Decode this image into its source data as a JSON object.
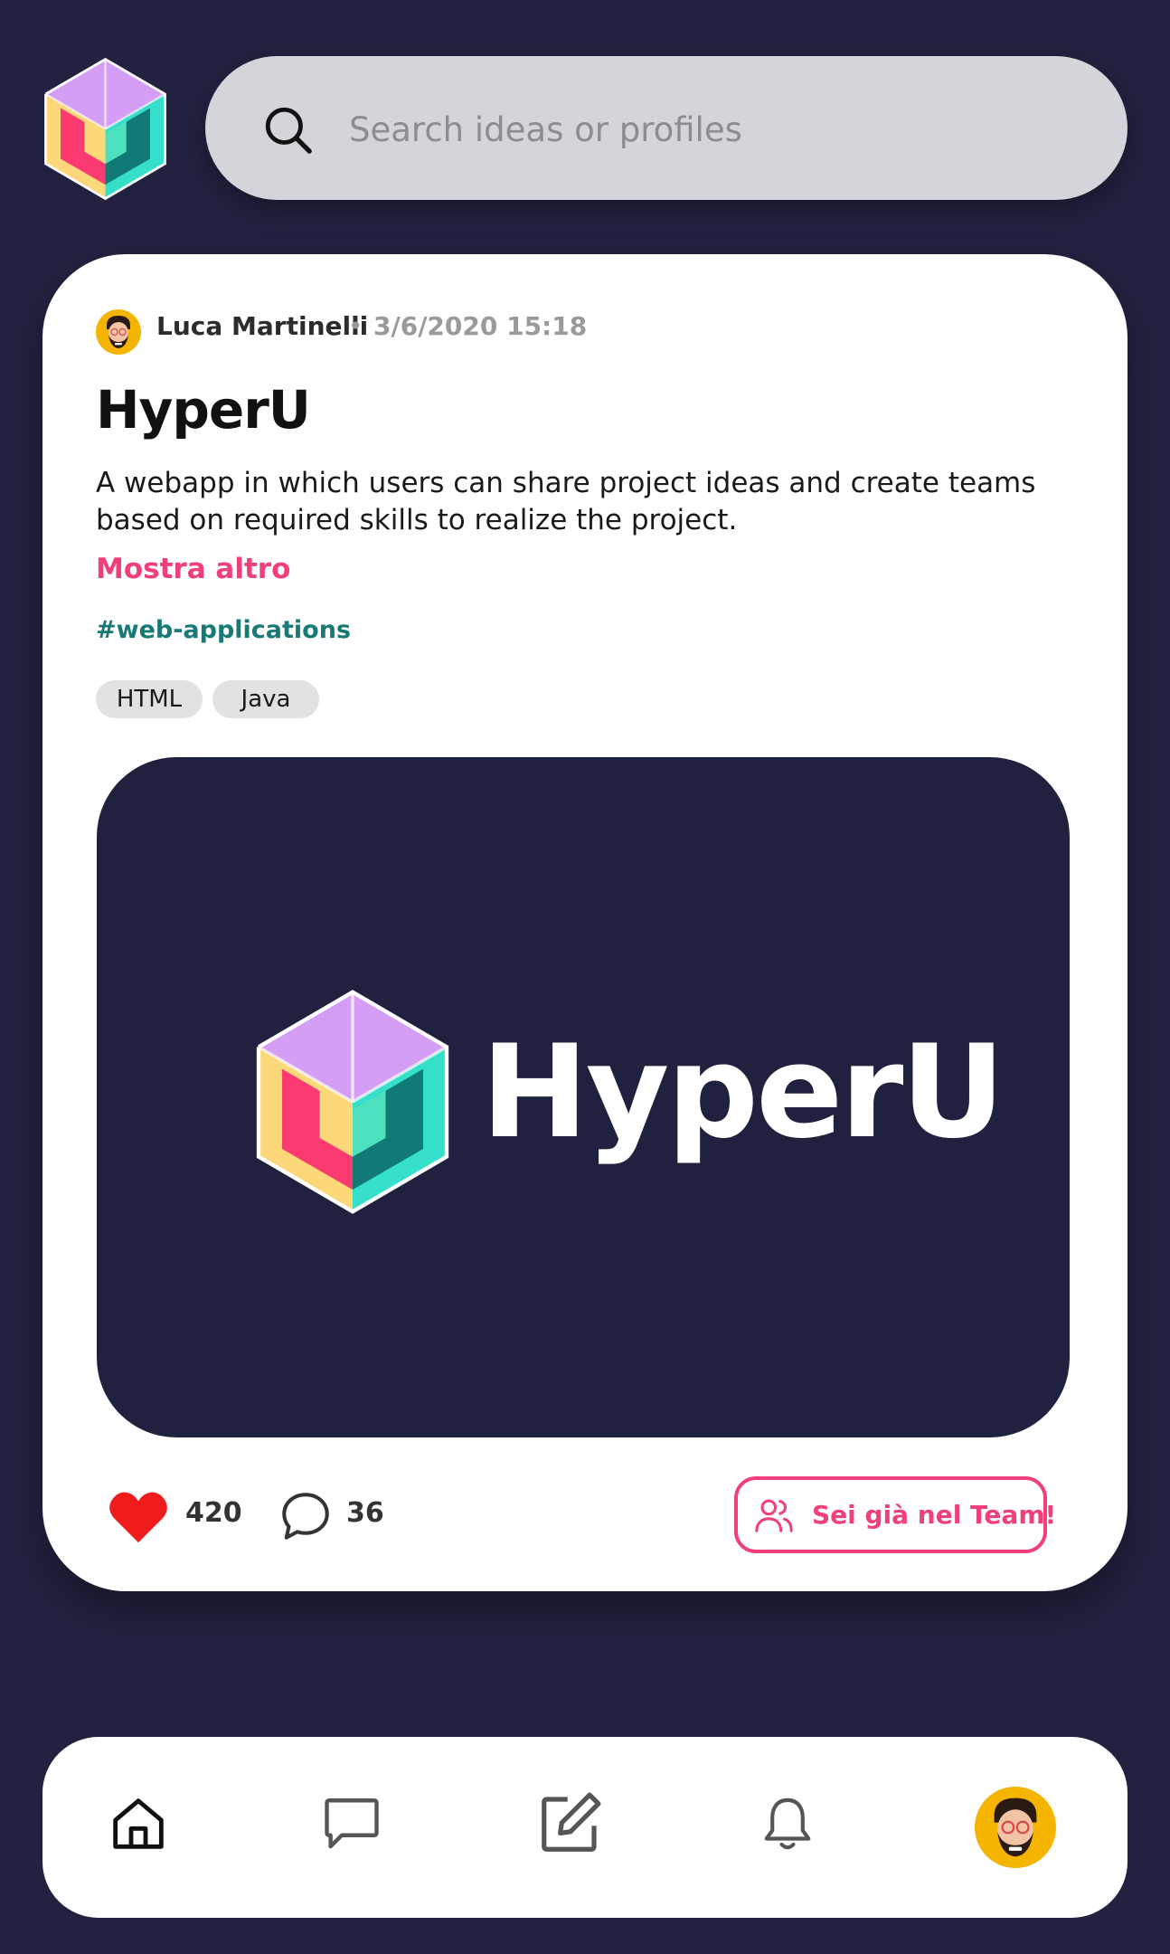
{
  "app": {
    "logo_icon": "hyperu-cube-logo-icon"
  },
  "search": {
    "placeholder": "Search ideas or profiles",
    "value": "",
    "icon": "search-icon"
  },
  "post": {
    "author_name": "Luca Martinelli",
    "separator": "•",
    "date": "3/6/2020 15:18",
    "title": "HyperU",
    "description": "A webapp in which users can share project ideas and create teams based on required skills to realize the project.",
    "show_more_label": "Mostra altro",
    "hashtag": "#web-applications",
    "skills": [
      "HTML",
      "Java"
    ],
    "cover_wordmark": "HyperU",
    "likes": "420",
    "comments": "36",
    "team_button_label": "Sei già nel Team!"
  },
  "nav": {
    "items": [
      {
        "icon": "home-icon",
        "active": true
      },
      {
        "icon": "messages-icon",
        "active": false
      },
      {
        "icon": "create-post-icon",
        "active": false
      },
      {
        "icon": "notifications-icon",
        "active": false
      },
      {
        "icon": "profile-avatar",
        "active": false
      }
    ]
  },
  "colors": {
    "background": "#222240",
    "card": "#ffffff",
    "accent_pink": "#f0407a",
    "hashtag_teal": "#177a76",
    "like_red": "#ee1c1c",
    "logo_purple": "#d59ef5",
    "logo_yellow": "#fdd87a",
    "logo_magenta": "#fb3a72",
    "logo_teal_dark": "#117a74",
    "logo_teal_light": "#34e0c9"
  }
}
